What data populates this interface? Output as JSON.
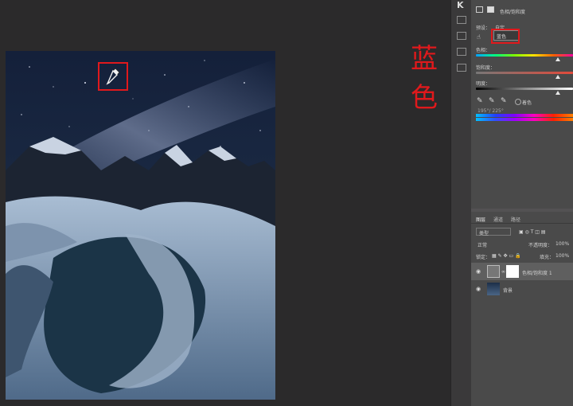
{
  "annotation": {
    "text": "蓝色"
  },
  "toolbar": {
    "k_label": "K"
  },
  "properties": {
    "title": "色相/饱和度",
    "preset_label": "预设：",
    "preset_value": "自定",
    "channel_value": "蓝色",
    "hue_label": "色相：",
    "saturation_label": "饱和度：",
    "lightness_label": "明度：",
    "colorize_label": "着色",
    "range_text": "195°/ 225°"
  },
  "layers": {
    "tabs": [
      "图层",
      "通道",
      "路径"
    ],
    "filter_label": "类型",
    "blend_mode": "正常",
    "opacity_label": "不透明度：",
    "opacity_value": "100%",
    "lock_label": "锁定：",
    "fill_label": "填充：",
    "fill_value": "100%",
    "items": [
      {
        "name": "色相/饱和度 1"
      },
      {
        "name": "背景"
      }
    ]
  },
  "colors": {
    "accent": "#e0191c"
  }
}
